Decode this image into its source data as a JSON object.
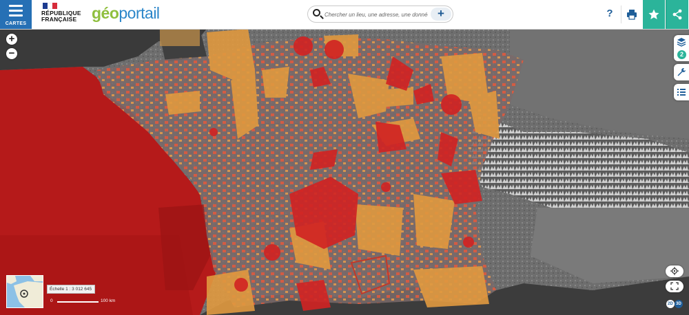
{
  "header": {
    "menu_label": "CARTES",
    "republique_line1": "RÉPUBLIQUE",
    "republique_line2": "FRANÇAISE",
    "brand_geo": "géo",
    "brand_portail": "portail",
    "search_placeholder": "Chercher un lieu, une adresse, une donnée",
    "search_add": "+",
    "help": "?"
  },
  "map": {
    "zoom_in": "+",
    "zoom_out": "−",
    "layers_count": "2",
    "scale_text": "Échelle 1 : 3 012 645",
    "scale_zero": "0",
    "scale_km": "100 km",
    "view_2d": "2D",
    "view_3d": "3D"
  },
  "colors": {
    "brand_blue": "#2670b5",
    "accent_green": "#2bb49a",
    "zone_red": "#c8201f",
    "zone_orange": "#e39a45"
  },
  "icons": [
    "menu-icon",
    "search-icon",
    "plus-icon",
    "help-icon",
    "print-icon",
    "star-icon",
    "share-icon",
    "layers-icon",
    "wrench-icon",
    "legend-icon",
    "geolocate-icon",
    "fullscreen-icon"
  ]
}
